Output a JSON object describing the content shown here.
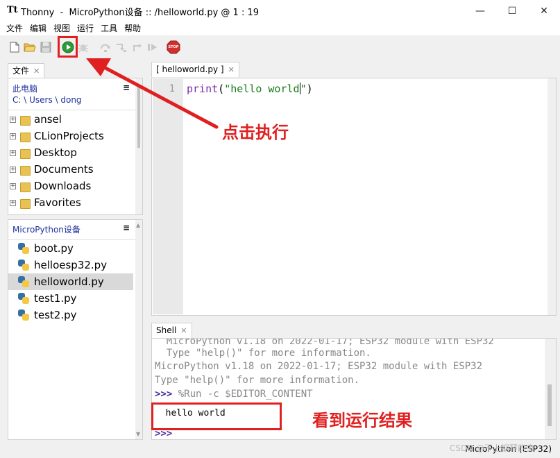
{
  "window": {
    "app_name": "Thonny",
    "title": "MicroPython设备 :: /helloworld.py  @  1 : 19",
    "minimize": "—",
    "maximize": "☐",
    "close": "✕"
  },
  "menu": [
    "文件",
    "编辑",
    "视图",
    "运行",
    "工具",
    "帮助"
  ],
  "toolbar": {
    "icons": [
      "new-file-icon",
      "open-folder-icon",
      "save-icon",
      "run-icon",
      "debug-icon",
      "step-over-icon",
      "step-into-icon",
      "step-out-icon",
      "resume-icon",
      "stop-icon"
    ],
    "stop_label": "STOP"
  },
  "files_panel": {
    "tab_label": "文件",
    "computer": {
      "title": "此电脑",
      "path": "C: \\ Users \\ dong",
      "items": [
        "ansel",
        "CLionProjects",
        "Desktop",
        "Documents",
        "Downloads",
        "Favorites"
      ]
    },
    "device": {
      "title": "MicroPython设备",
      "items": [
        "boot.py",
        "helloesp32.py",
        "helloworld.py",
        "test1.py",
        "test2.py"
      ],
      "selected": "helloworld.py"
    }
  },
  "editor": {
    "tab_label": "[ helloworld.py ]",
    "line_number": "1",
    "code_func": "print",
    "code_open": "(",
    "code_string": "\"hello world",
    "code_string_end": "\"",
    "code_close": ")"
  },
  "shell": {
    "tab_label": "Shell",
    "lines": [
      "  MicroPython v1.18 on 2022-01-17; ESP32 module with ESP32",
      "  Type \"help()\" for more information.",
      "MicroPython v1.18 on 2022-01-17; ESP32 module with ESP32",
      "Type \"help()\" for more information."
    ],
    "prompt": ">>>",
    "command": " %Run -c $EDITOR_CONTENT",
    "output": "  hello world",
    "final_prompt": ">>>"
  },
  "status": {
    "interpreter": "MicroPython (ESP32)",
    "watermark": "CSDN @不上钢琴的虫"
  },
  "annotations": {
    "run_hint": "点击执行",
    "result_hint": "看到运行结果",
    "color": "#e02020"
  }
}
